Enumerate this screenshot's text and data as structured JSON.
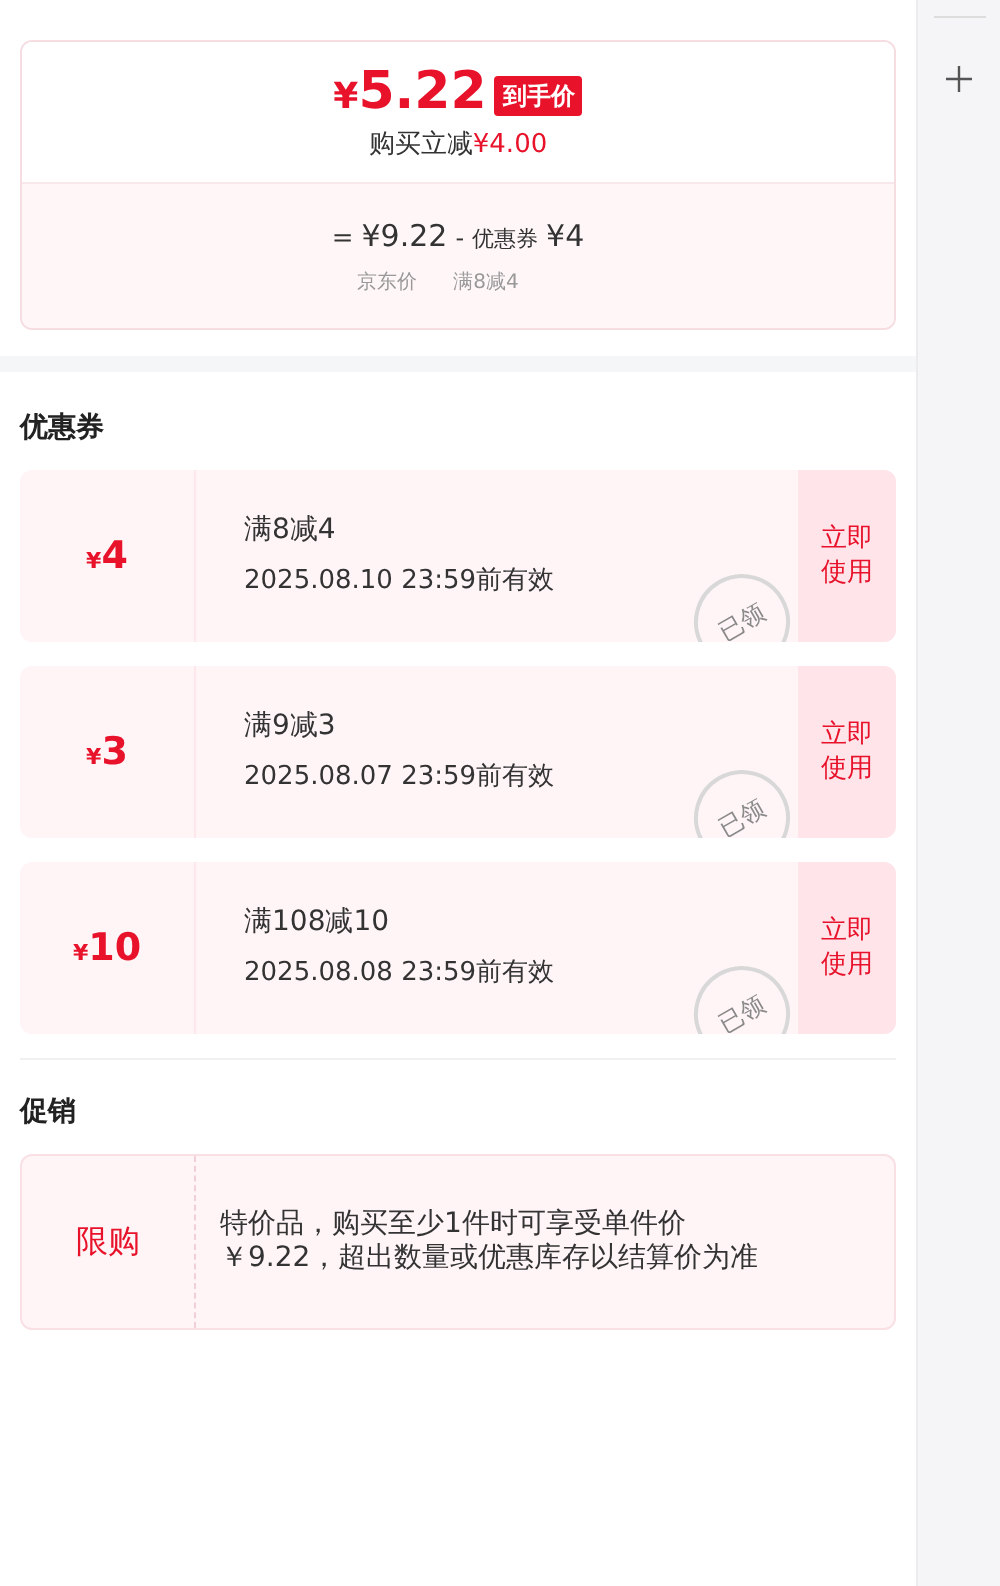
{
  "price_card": {
    "currency": "¥",
    "price": "5.22",
    "price_tag": "到手价",
    "saving_label": "购买立减",
    "saving_amount": "¥4.00",
    "equals": "=",
    "base_price": "¥9.22",
    "minus": "-",
    "coupon_label": "优惠券",
    "coupon_amount": "¥4",
    "base_caption": "京东价",
    "coupon_caption": "满8减4"
  },
  "coupons_title": "优惠券",
  "coupons": [
    {
      "currency": "¥",
      "amount": "4",
      "condition": "满8减4",
      "expiry": "2025.08.10 23:59前有效",
      "stamp": "已领",
      "action": "立即使用"
    },
    {
      "currency": "¥",
      "amount": "3",
      "condition": "满9减3",
      "expiry": "2025.08.07 23:59前有效",
      "stamp": "已领",
      "action": "立即使用"
    },
    {
      "currency": "¥",
      "amount": "10",
      "condition": "满108减10",
      "expiry": "2025.08.08 23:59前有效",
      "stamp": "已领",
      "action": "立即使用"
    }
  ],
  "promotions_title": "促销",
  "promotions": [
    {
      "tag": "限购",
      "description": "特价品，购买至少1件时可享受单件价￥9.22，超出数量或优惠库存以结算价为准"
    }
  ]
}
